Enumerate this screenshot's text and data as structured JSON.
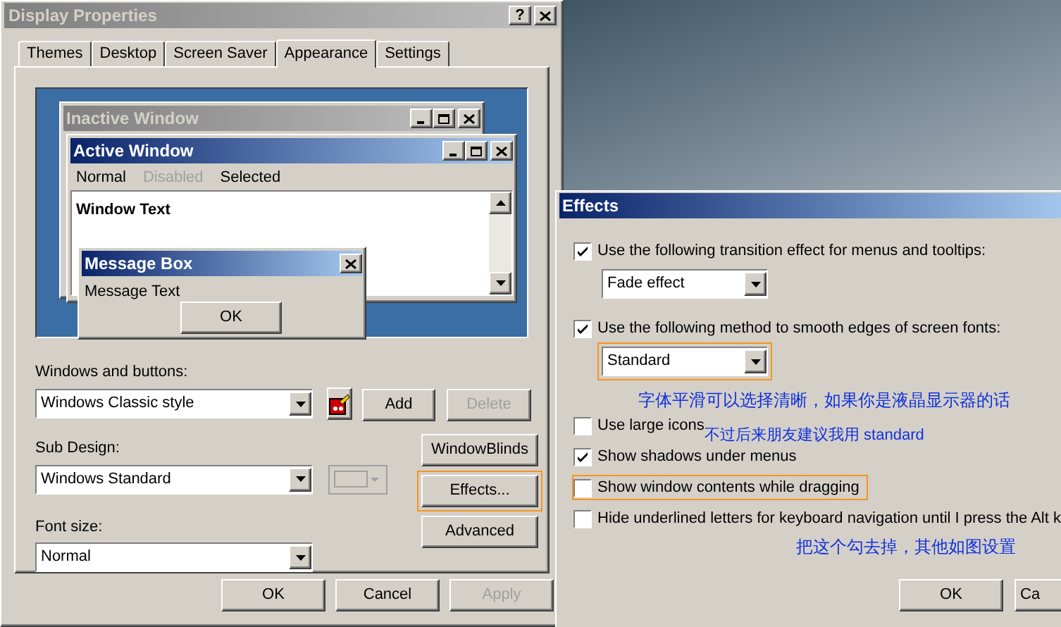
{
  "display_properties": {
    "title": "Display Properties",
    "help_button": "?",
    "tabs": [
      {
        "label": "Themes",
        "selected": false
      },
      {
        "label": "Desktop",
        "selected": false
      },
      {
        "label": "Screen Saver",
        "selected": false
      },
      {
        "label": "Appearance",
        "selected": true
      },
      {
        "label": "Settings",
        "selected": false
      }
    ],
    "preview": {
      "inactive_window": {
        "title": "Inactive Window"
      },
      "active_window": {
        "title": "Active Window",
        "menu": [
          {
            "label": "Normal",
            "disabled": false
          },
          {
            "label": "Disabled",
            "disabled": true
          },
          {
            "label": "Selected",
            "disabled": false
          }
        ],
        "window_text": "Window Text"
      },
      "message_box": {
        "title": "Message Box",
        "text": "Message Text",
        "button": "OK"
      }
    },
    "windows_and_buttons": {
      "label": "Windows and buttons:",
      "value": "Windows Classic style"
    },
    "add_button": {
      "label": "Add",
      "disabled": false
    },
    "delete_button": {
      "label": "Delete",
      "disabled": true
    },
    "sub_design": {
      "label": "Sub Design:",
      "value": "Windows Standard"
    },
    "windowblinds_button": {
      "label": "WindowBlinds",
      "highlighted": false
    },
    "effects_button": {
      "label": "Effects...",
      "highlighted": true
    },
    "font_size": {
      "label": "Font size:",
      "value": "Normal"
    },
    "advanced_button": {
      "label": "Advanced",
      "highlighted": false
    },
    "buttons": [
      {
        "label": "OK",
        "disabled": false
      },
      {
        "label": "Cancel",
        "disabled": false
      },
      {
        "label": "Apply",
        "disabled": true
      }
    ]
  },
  "effects": {
    "title": "Effects",
    "options": [
      {
        "kind": "checkbox",
        "label": "Use the following transition effect for menus and tooltips:",
        "checked": true,
        "highlighted": false
      },
      {
        "kind": "dropdown",
        "value": "Fade effect",
        "highlighted": false
      },
      {
        "kind": "checkbox",
        "label": "Use the following method to smooth edges of screen fonts:",
        "checked": true,
        "highlighted": false
      },
      {
        "kind": "dropdown",
        "value": "Standard",
        "highlighted": true
      },
      {
        "kind": "note",
        "text": "字体平滑可以选择清晰，如果你是液晶显示器的话"
      },
      {
        "kind": "checkbox",
        "label": "Use large icons",
        "checked": false,
        "highlighted": false,
        "note": "不过后来朋友建议我用 standard"
      },
      {
        "kind": "checkbox",
        "label": "Show shadows under menus",
        "checked": true,
        "highlighted": false
      },
      {
        "kind": "checkbox",
        "label": "Show window contents while dragging",
        "checked": false,
        "highlighted": true
      },
      {
        "kind": "checkbox",
        "label": "Hide underlined letters for keyboard navigation until I press the Alt k",
        "checked": false,
        "highlighted": false
      },
      {
        "kind": "note",
        "text": "把这个勾去掉，其他如图设置"
      }
    ],
    "buttons": [
      {
        "label": "OK"
      },
      {
        "label": "Ca"
      }
    ]
  }
}
